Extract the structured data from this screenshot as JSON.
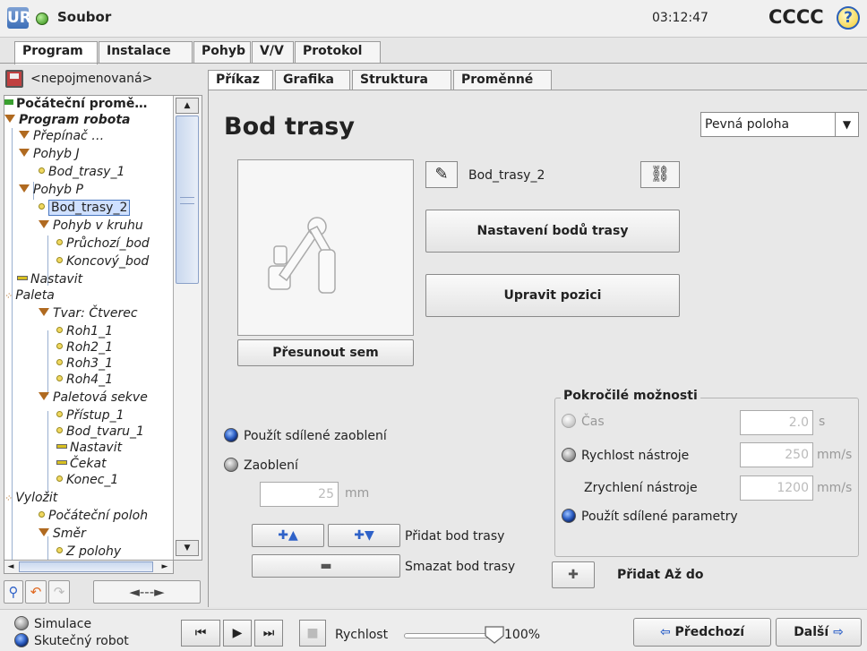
{
  "topbar": {
    "logo": "UR",
    "file_menu": "Soubor",
    "time": "03:12:47",
    "user": "CCCC",
    "help": "?"
  },
  "main_tabs": [
    {
      "label": "Program",
      "active": true
    },
    {
      "label": "Instalace",
      "active": false
    },
    {
      "label": "Pohyb",
      "active": false
    },
    {
      "label": "V/V",
      "active": false
    },
    {
      "label": "Protokol",
      "active": false
    }
  ],
  "program_name": "<nepojmenovaná>",
  "tree": [
    {
      "label": "Počáteční promě…",
      "marker": "green",
      "style": "bold"
    },
    {
      "label": "Program robota",
      "marker": "tri",
      "style": "bold-italic"
    },
    {
      "label": "Přepínač …",
      "marker": "tri",
      "style": "italic"
    },
    {
      "label": "Pohyb J",
      "marker": "tri",
      "style": "italic"
    },
    {
      "label": "Bod_trasy_1",
      "marker": "dot",
      "style": "italic"
    },
    {
      "label": "Pohyb P",
      "marker": "tri",
      "style": "italic"
    },
    {
      "label": "Bod_trasy_2",
      "marker": "dot",
      "style": "selected"
    },
    {
      "label": "Pohyb v kruhu",
      "marker": "tri",
      "style": "italic"
    },
    {
      "label": "Průchozí_bod",
      "marker": "dot",
      "style": "italic"
    },
    {
      "label": "Koncový_bod",
      "marker": "dot",
      "style": "italic"
    },
    {
      "label": "Nastavit",
      "marker": "yellow",
      "style": "italic"
    },
    {
      "label": "Paleta",
      "marker": "pal",
      "style": "italic"
    },
    {
      "label": "Tvar: Čtverec",
      "marker": "tri",
      "style": "italic"
    },
    {
      "label": "Roh1_1",
      "marker": "dot",
      "style": "italic"
    },
    {
      "label": "Roh2_1",
      "marker": "dot",
      "style": "italic"
    },
    {
      "label": "Roh3_1",
      "marker": "dot",
      "style": "italic"
    },
    {
      "label": "Roh4_1",
      "marker": "dot",
      "style": "italic"
    },
    {
      "label": "Paletová sekve",
      "marker": "tri",
      "style": "italic"
    },
    {
      "label": "Přístup_1",
      "marker": "dot",
      "style": "italic"
    },
    {
      "label": "Bod_tvaru_1",
      "marker": "dot",
      "style": "italic"
    },
    {
      "label": "Nastavit",
      "marker": "yellow",
      "style": "italic"
    },
    {
      "label": "Čekat",
      "marker": "yellow",
      "style": "italic"
    },
    {
      "label": "Konec_1",
      "marker": "dot",
      "style": "italic"
    },
    {
      "label": "Vyložit",
      "marker": "pal",
      "style": "italic"
    },
    {
      "label": "Počáteční poloh",
      "marker": "dot",
      "style": "italic"
    },
    {
      "label": "Směr",
      "marker": "tri",
      "style": "italic"
    },
    {
      "label": "Z polohy",
      "marker": "dot",
      "style": "italic"
    }
  ],
  "left_tools": {
    "search": "⚲",
    "undo": "↶",
    "redo": "↷",
    "expand": "◄---►"
  },
  "sub_tabs": [
    {
      "label": "Příkaz",
      "active": true
    },
    {
      "label": "Grafika",
      "active": false
    },
    {
      "label": "Struktura",
      "active": false
    },
    {
      "label": "Proměnné",
      "active": false
    }
  ],
  "waypoint": {
    "title": "Bod trasy",
    "mode": "Pevná poloha",
    "name": "Bod_trasy_2",
    "setup_button": "Nastavení bodů trasy",
    "edit_pose_button": "Upravit pozici",
    "move_here_button": "Přesunout sem"
  },
  "blend": {
    "shared_label": "Použít sdílené zaoblení",
    "blend_label": "Zaoblení",
    "blend_value": "25",
    "blend_unit": "mm",
    "add_waypoint_label": "Přidat bod trasy",
    "delete_waypoint_label": "Smazat bod trasy",
    "add_before": "✚▲",
    "add_after": "✚▼",
    "delete": "▬"
  },
  "advanced": {
    "title": "Pokročilé možnosti",
    "time_label": "Čas",
    "time_value": "2.0",
    "time_unit": "s",
    "tool_speed_label": "Rychlost nástroje",
    "tool_speed_value": "250",
    "tool_speed_unit": "mm/s",
    "tool_accel_label": "Zrychlení nástroje",
    "tool_accel_value": "1200",
    "tool_accel_unit": "mm/s",
    "shared_params_label": "Použít sdílené parametry"
  },
  "add_until": {
    "icon": "✚",
    "label": "Přidat Až do"
  },
  "bottombar": {
    "simulation_label": "Simulace",
    "real_robot_label": "Skutečný robot",
    "speed_label": "Rychlost",
    "speed_value": "100%",
    "speed_fraction": 1.0,
    "prev_label": "Předchozí",
    "next_label": "Další",
    "prev_icon": "⇦",
    "next_icon": "⇨"
  },
  "colors": {
    "accent_blue": "#2f62c8",
    "status_green": "#2e8a10",
    "node_orange": "#b06a20"
  }
}
